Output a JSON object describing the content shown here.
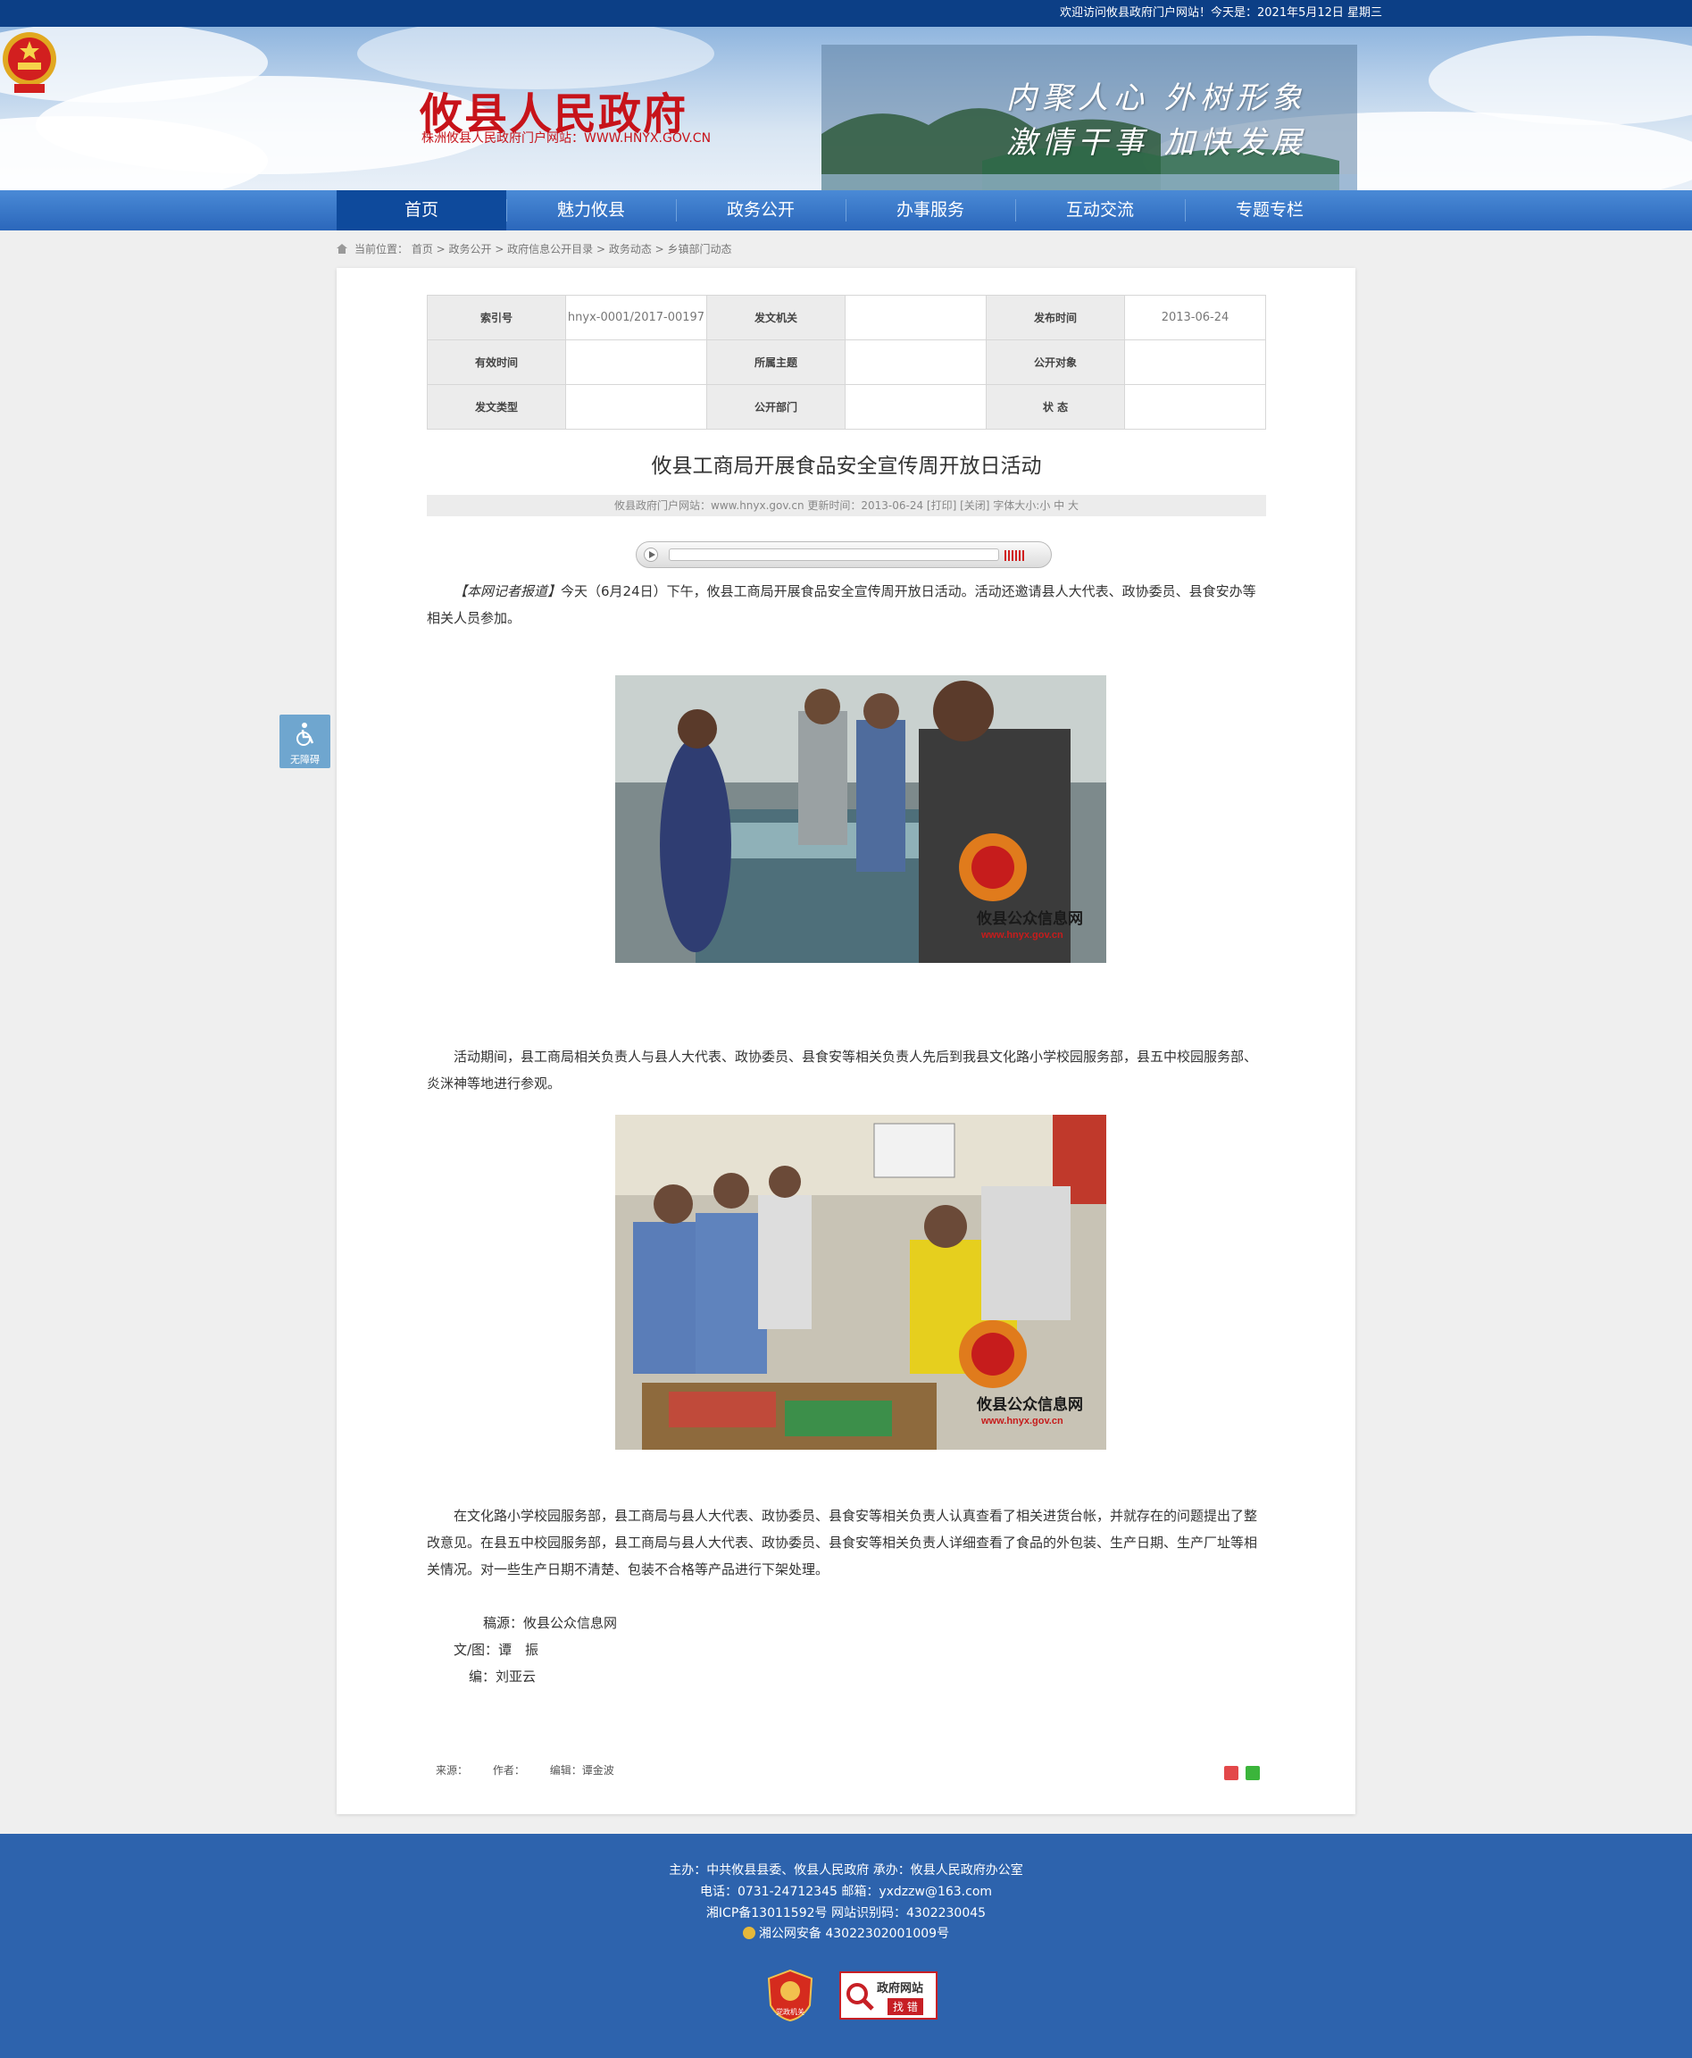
{
  "topbar": {
    "welcome": "欢迎访问攸县政府门户网站！今天是：2021年5月12日 星期三"
  },
  "header": {
    "site_title": "攸县人民政府",
    "site_url": "株洲攸县人民政府门户网站：WWW.HNYX.GOV.CN",
    "slogan_line1": "内聚人心 外树形象",
    "slogan_line2": "激情干事 加快发展"
  },
  "nav": {
    "items": [
      "首页",
      "魅力攸县",
      "政务公开",
      "办事服务",
      "互动交流",
      "专题专栏"
    ],
    "active": "首页"
  },
  "breadcrumb": {
    "text": "当前位置： 首页 > 政务公开 > 政府信息公开目录 > 政务动态 > 乡镇部门动态"
  },
  "meta_table": {
    "row1": {
      "l1": "索引号",
      "v1": "hnyx-0001/2017-00197",
      "l2": "发文机关",
      "v2": "",
      "l3": "发布时间",
      "v3": "2013-06-24"
    },
    "row2": {
      "l1": "有效时间",
      "v1": "",
      "l2": "所属主题",
      "v2": "",
      "l3": "公开对象",
      "v3": ""
    },
    "row3": {
      "l1": "发文类型",
      "v1": "",
      "l2": "公开部门",
      "v2": "",
      "l3": "状 态",
      "v3": ""
    }
  },
  "article": {
    "title": "攸县工商局开展食品安全宣传周开放日活动",
    "info": "攸县政府门户网站：www.hnyx.gov.cn  更新时间：2013-06-24  [打印] [关闭]  字体大小:小 中 大",
    "lead_tag": "【本网记者报道】",
    "p1": "今天（6月24日）下午，攸县工商局开展食品安全宣传周开放日活动。活动还邀请县人大代表、政协委员、县食安办等相关人员参加。",
    "p2": "活动期间，县工商局相关负责人与县人大代表、政协委员、县食安等相关负责人先后到我县文化路小学校园服务部，县五中校园服务部、炎洣神等地进行参观。",
    "p3": "在文化路小学校园服务部，县工商局与县人大代表、政协委员、县食安等相关负责人认真查看了相关进货台帐，并就存在的问题提出了整改意见。在县五中校园服务部，县工商局与县人大代表、政协委员、县食安等相关负责人详细查看了食品的外包装、生产日期、生产厂址等相关情况。对一些生产日期不清楚、包装不合格等产品进行下架处理。",
    "photo_watermark_cn": "攸县公众信息网",
    "photo_watermark_url": "www.hnyx.gov.cn",
    "sig_source": "稿源：攸县公众信息网",
    "sig_author": "文/图：谭　振",
    "sig_editor": "编：刘亚云"
  },
  "article_footer": {
    "source": "来源：",
    "author": "作者：",
    "editor": "编辑：谭金波"
  },
  "accessibility": {
    "label": "无障碍"
  },
  "footer": {
    "line1": "主办：中共攸县县委、攸县人民政府 承办：攸县人民政府办公室",
    "line2": "电话：0731-24712345 邮箱：yxdzzw@163.com",
    "line3": "湘ICP备13011592号   网站识别码：4302230045",
    "line4": "湘公网安备 43022302001009号",
    "badge1_label": "党政机关",
    "badge2_top": "政府网站",
    "badge2_bottom": "找 错"
  },
  "colors": {
    "topbar": "#0c3f86",
    "nav": "#2b67bb",
    "nav_active": "#0e4a9c",
    "footer": "#2d63ad",
    "title_red": "#c7131a"
  }
}
